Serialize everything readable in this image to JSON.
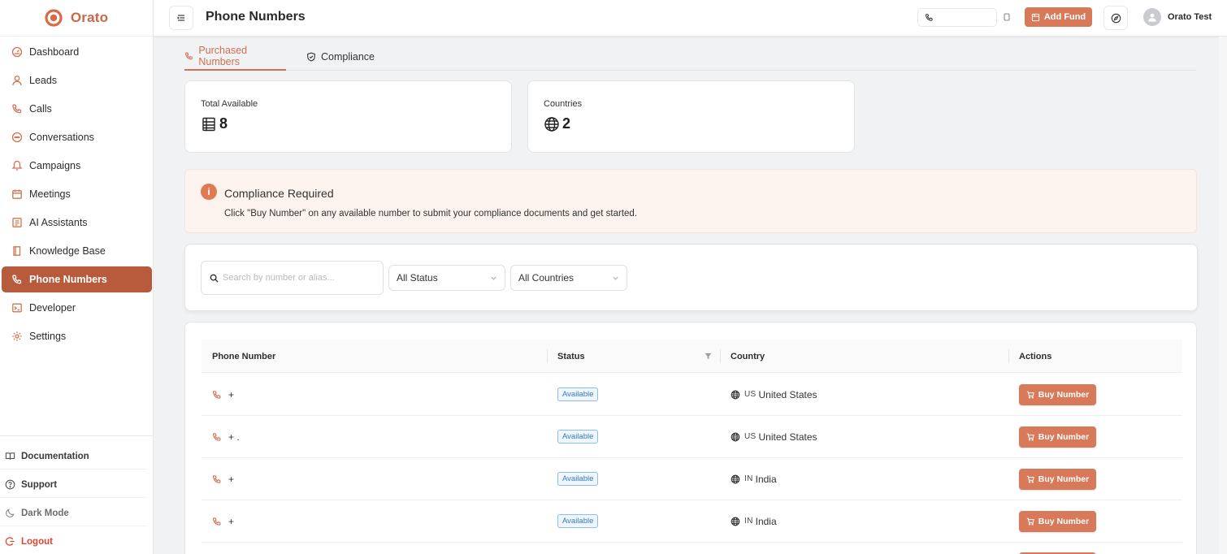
{
  "brand": {
    "name": "Orato"
  },
  "sidebar": {
    "items": [
      {
        "label": "Dashboard",
        "icon": "dashboard-icon",
        "active": false
      },
      {
        "label": "Leads",
        "icon": "user-icon",
        "active": false
      },
      {
        "label": "Calls",
        "icon": "phone-icon",
        "active": false
      },
      {
        "label": "Conversations",
        "icon": "chat-icon",
        "active": false
      },
      {
        "label": "Campaigns",
        "icon": "megaphone-icon",
        "active": false
      },
      {
        "label": "Meetings",
        "icon": "calendar-icon",
        "active": false
      },
      {
        "label": "AI Assistants",
        "icon": "assistant-icon",
        "active": false
      },
      {
        "label": "Knowledge Base",
        "icon": "book-icon",
        "active": false
      },
      {
        "label": "Phone Numbers",
        "icon": "phone-icon",
        "active": true
      },
      {
        "label": "Developer",
        "icon": "terminal-icon",
        "active": false
      },
      {
        "label": "Settings",
        "icon": "gear-icon",
        "active": false
      }
    ],
    "bottom": {
      "documentation": "Documentation",
      "support": "Support",
      "dark_mode": "Dark Mode",
      "logout": "Logout"
    }
  },
  "header": {
    "title": "Phone Numbers",
    "phone_value": "",
    "add_fund": "Add Fund",
    "user_name": "Orato Test"
  },
  "tabs": [
    {
      "label": "Purchased Numbers",
      "active": true
    },
    {
      "label": "Compliance",
      "active": false
    }
  ],
  "stats": {
    "total_label": "Total Available",
    "total_value": "8",
    "countries_label": "Countries",
    "countries_value": "2"
  },
  "banner": {
    "title": "Compliance Required",
    "description": "Click \"Buy Number\" on any available number to submit your compliance documents and get started."
  },
  "filters": {
    "search_placeholder": "Search by number or alias...",
    "status": "All Status",
    "country": "All Countries"
  },
  "table": {
    "columns": [
      "Phone Number",
      "Status",
      "Country",
      "Actions"
    ],
    "rows": [
      {
        "number": "+",
        "status": "Available",
        "code": "US",
        "country": "United States",
        "action": "Buy Number"
      },
      {
        "number": "+ .",
        "status": "Available",
        "code": "US",
        "country": "United States",
        "action": "Buy Number"
      },
      {
        "number": "+",
        "status": "Available",
        "code": "IN",
        "country": "India",
        "action": "Buy Number"
      },
      {
        "number": "+",
        "status": "Available",
        "code": "IN",
        "country": "India",
        "action": "Buy Number"
      }
    ]
  },
  "colors": {
    "accent": "#d8795a",
    "active_nav": "#b85b3d",
    "banner_bg": "#fdf3ee",
    "badge_blue": "#3a7ab8",
    "logout": "#d9472f"
  }
}
